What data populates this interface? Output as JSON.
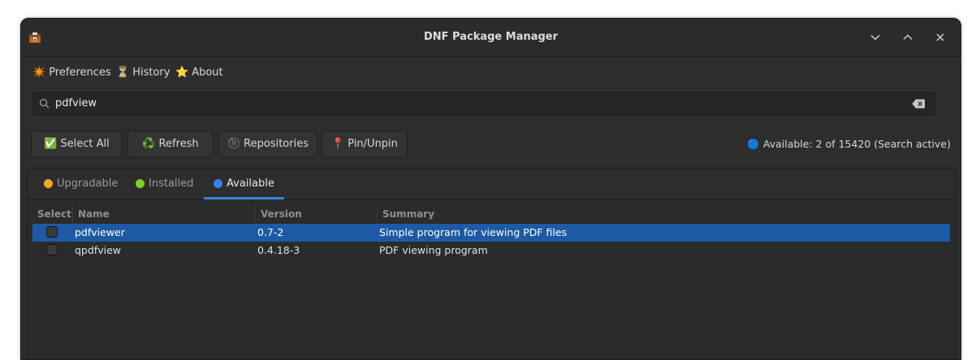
{
  "window": {
    "title": "DNF Package Manager",
    "controls": [
      "chevron-down-icon",
      "chevron-up-icon",
      "close-icon"
    ]
  },
  "menu": [
    {
      "icon": "✴️",
      "label": "Preferences",
      "icon_name": "sparkle-icon"
    },
    {
      "icon": "⏳",
      "label": "History",
      "icon_name": "hourglass-icon"
    },
    {
      "icon": "⭐",
      "label": "About",
      "icon_name": "star-icon"
    }
  ],
  "search": {
    "value": "pdfview",
    "icon": "search-icon",
    "clear_icon": "backspace-icon"
  },
  "toolbar": {
    "select_all": {
      "icon": "✅",
      "label": "Select All"
    },
    "refresh": {
      "icon": "♻️",
      "label": "Refresh"
    },
    "repositories": {
      "icon": "®️",
      "label": "Repositories"
    },
    "pin": {
      "icon": "📍",
      "label": "Pin/Unpin"
    }
  },
  "status": {
    "icon": "🔵",
    "text": "Available: 2 of 15420 (Search active)"
  },
  "tabs": [
    {
      "label": "Upgradable",
      "color": "#f5a623",
      "active": false
    },
    {
      "label": "Installed",
      "color": "#7ed321",
      "active": false
    },
    {
      "label": "Available",
      "color": "#3584e4",
      "active": true
    }
  ],
  "table": {
    "columns": [
      "Select",
      "Name",
      "Version",
      "Summary"
    ],
    "rows": [
      {
        "checked": false,
        "name": "pdfviewer",
        "version": "0.7-2",
        "summary": "Simple program for viewing PDF files",
        "selected": true
      },
      {
        "checked": false,
        "name": "qpdfview",
        "version": "0.4.18-3",
        "summary": "PDF viewing program",
        "selected": false
      }
    ]
  },
  "colors": {
    "accent": "#3584e4",
    "selection": "#1c5aa6",
    "background": "#2d2d2d"
  }
}
